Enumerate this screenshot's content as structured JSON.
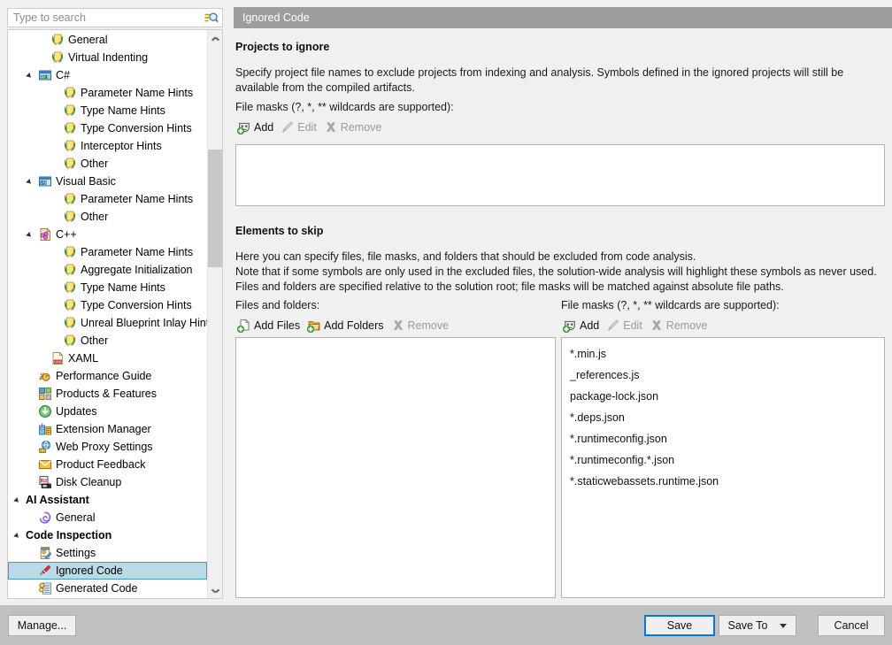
{
  "search": {
    "placeholder": "Type to search",
    "value": "",
    "icon": "search-icon"
  },
  "tree": {
    "items": [
      {
        "label": "General",
        "indent": 3,
        "icon": "hint-bulb-icon",
        "expander": "none",
        "type": "leaf"
      },
      {
        "label": "Virtual Indenting",
        "indent": 3,
        "icon": "hint-bulb-icon",
        "expander": "none",
        "type": "leaf"
      },
      {
        "label": "C#",
        "indent": 2,
        "icon": "csharp-icon",
        "expander": "expanded",
        "type": "node"
      },
      {
        "label": "Parameter Name Hints",
        "indent": 4,
        "icon": "hint-bulb-icon",
        "expander": "none",
        "type": "leaf"
      },
      {
        "label": "Type Name Hints",
        "indent": 4,
        "icon": "hint-bulb-icon",
        "expander": "none",
        "type": "leaf"
      },
      {
        "label": "Type Conversion Hints",
        "indent": 4,
        "icon": "hint-bulb-icon",
        "expander": "none",
        "type": "leaf"
      },
      {
        "label": "Interceptor Hints",
        "indent": 4,
        "icon": "hint-bulb-icon",
        "expander": "none",
        "type": "leaf"
      },
      {
        "label": "Other",
        "indent": 4,
        "icon": "hint-bulb-icon",
        "expander": "none",
        "type": "leaf"
      },
      {
        "label": "Visual Basic",
        "indent": 2,
        "icon": "vb-icon",
        "expander": "expanded",
        "type": "node"
      },
      {
        "label": "Parameter Name Hints",
        "indent": 4,
        "icon": "hint-bulb-icon",
        "expander": "none",
        "type": "leaf"
      },
      {
        "label": "Other",
        "indent": 4,
        "icon": "hint-bulb-icon",
        "expander": "none",
        "type": "leaf"
      },
      {
        "label": "C++",
        "indent": 2,
        "icon": "cpp-icon",
        "expander": "expanded",
        "type": "node"
      },
      {
        "label": "Parameter Name Hints",
        "indent": 4,
        "icon": "hint-bulb-icon",
        "expander": "none",
        "type": "leaf"
      },
      {
        "label": "Aggregate Initialization",
        "indent": 4,
        "icon": "hint-bulb-icon",
        "expander": "none",
        "type": "leaf"
      },
      {
        "label": "Type Name Hints",
        "indent": 4,
        "icon": "hint-bulb-icon",
        "expander": "none",
        "type": "leaf"
      },
      {
        "label": "Type Conversion Hints",
        "indent": 4,
        "icon": "hint-bulb-icon",
        "expander": "none",
        "type": "leaf"
      },
      {
        "label": "Unreal Blueprint Inlay Hints",
        "indent": 4,
        "icon": "hint-bulb-icon",
        "expander": "none",
        "type": "leaf"
      },
      {
        "label": "Other",
        "indent": 4,
        "icon": "hint-bulb-icon",
        "expander": "none",
        "type": "leaf"
      },
      {
        "label": "XAML",
        "indent": 3,
        "icon": "xaml-icon",
        "expander": "none",
        "type": "leaf"
      },
      {
        "label": "Performance Guide",
        "indent": 2,
        "icon": "performance-guide-icon",
        "expander": "none",
        "type": "leaf"
      },
      {
        "label": "Products & Features",
        "indent": 2,
        "icon": "products-features-icon",
        "expander": "none",
        "type": "leaf"
      },
      {
        "label": "Updates",
        "indent": 2,
        "icon": "updates-icon",
        "expander": "none",
        "type": "leaf"
      },
      {
        "label": "Extension Manager",
        "indent": 2,
        "icon": "extension-manager-icon",
        "expander": "none",
        "type": "leaf"
      },
      {
        "label": "Web Proxy Settings",
        "indent": 2,
        "icon": "web-proxy-icon",
        "expander": "none",
        "type": "leaf"
      },
      {
        "label": "Product Feedback",
        "indent": 2,
        "icon": "product-feedback-icon",
        "expander": "none",
        "type": "leaf"
      },
      {
        "label": "Disk Cleanup",
        "indent": 2,
        "icon": "disk-cleanup-icon",
        "expander": "none",
        "type": "leaf"
      },
      {
        "label": "AI Assistant",
        "indent": 1,
        "icon": "none",
        "expander": "expanded",
        "type": "group"
      },
      {
        "label": "General",
        "indent": 2,
        "icon": "ai-general-icon",
        "expander": "none",
        "type": "leaf"
      },
      {
        "label": "Code Inspection",
        "indent": 1,
        "icon": "none",
        "expander": "expanded",
        "type": "group"
      },
      {
        "label": "Settings",
        "indent": 2,
        "icon": "inspection-settings-icon",
        "expander": "none",
        "type": "leaf"
      },
      {
        "label": "Ignored Code",
        "indent": 2,
        "icon": "ignored-code-icon",
        "expander": "none",
        "type": "leaf",
        "selected": true
      },
      {
        "label": "Generated Code",
        "indent": 2,
        "icon": "generated-code-icon",
        "expander": "none",
        "type": "leaf"
      }
    ],
    "scrollbar": {
      "up_icon": "chevron-up-icon",
      "down_icon": "chevron-down-icon"
    }
  },
  "page": {
    "header_title": "Ignored Code",
    "projects_to_ignore": {
      "title": "Projects to ignore",
      "description": "Specify project file names to exclude projects from indexing and analysis. Symbols defined in the ignored projects will still be available from the compiled artifacts.",
      "masks_label": "File masks (?, *, ** wildcards are supported):",
      "toolbar": [
        {
          "label": "Add",
          "icon": "add-mask-icon",
          "enabled": true
        },
        {
          "label": "Edit",
          "icon": "edit-pencil-icon",
          "enabled": false
        },
        {
          "label": "Remove",
          "icon": "remove-x-icon",
          "enabled": false
        }
      ],
      "items": []
    },
    "elements_to_skip": {
      "title": "Elements to skip",
      "description_lines": [
        "Here you can specify files, file masks, and folders that should be excluded from code analysis.",
        "Note that if some symbols are only used in the excluded files, the solution-wide analysis will highlight these symbols as never used.",
        "Files and folders are specified relative to the solution root; file masks will be matched against absolute file paths."
      ],
      "files_folders": {
        "label": "Files and folders:",
        "toolbar": [
          {
            "label": "Add Files",
            "icon": "add-file-icon",
            "enabled": true
          },
          {
            "label": "Add Folders",
            "icon": "add-folder-icon",
            "enabled": true
          },
          {
            "label": "Remove",
            "icon": "remove-x-icon",
            "enabled": false
          }
        ],
        "items": []
      },
      "file_masks": {
        "label": "File masks (?, *, ** wildcards are supported):",
        "toolbar": [
          {
            "label": "Add",
            "icon": "add-mask-icon",
            "enabled": true
          },
          {
            "label": "Edit",
            "icon": "edit-pencil-icon",
            "enabled": false
          },
          {
            "label": "Remove",
            "icon": "remove-x-icon",
            "enabled": false
          }
        ],
        "items": [
          "*.min.js",
          "_references.js",
          "package-lock.json",
          "*.deps.json",
          "*.runtimeconfig.json",
          "*.runtimeconfig.*.json",
          "*.staticwebassets.runtime.json"
        ]
      }
    }
  },
  "footer": {
    "manage_label": "Manage...",
    "save_label": "Save",
    "save_to_label": "Save To",
    "save_to_caret": "chevron-down-icon",
    "cancel_label": "Cancel"
  },
  "colors": {
    "window_background": "#f0f0f0",
    "header_bar": "#9d9d9d",
    "header_text": "#ffffff",
    "selection_fill": "#bcd9ea",
    "selection_border": "#4a9ac4",
    "default_button_border": "#0078d7",
    "bottom_bar": "#c0c0c0",
    "list_background": "#ffffff"
  }
}
